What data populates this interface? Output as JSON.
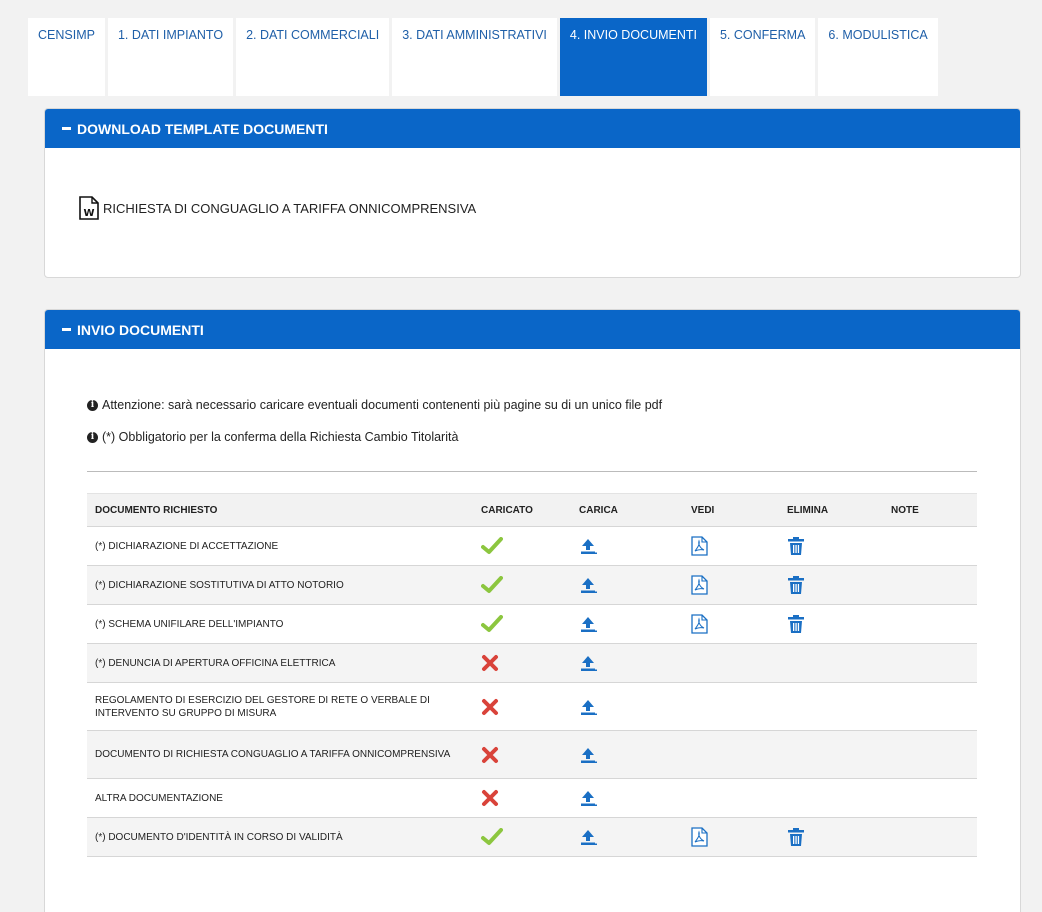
{
  "tabs": [
    {
      "label": "CENSIMP",
      "active": false
    },
    {
      "label": "1. DATI IMPIANTO",
      "active": false
    },
    {
      "label": "2. DATI COMMERCIALI",
      "active": false
    },
    {
      "label": "3. DATI AMMINISTRATIVI",
      "active": false
    },
    {
      "label": "4. INVIO DOCUMENTI",
      "active": true
    },
    {
      "label": "5. CONFERMA",
      "active": false
    },
    {
      "label": "6. MODULISTICA",
      "active": false
    }
  ],
  "download_panel": {
    "title": "DOWNLOAD TEMPLATE DOCUMENTI",
    "template_link": "RICHIESTA DI CONGUAGLIO A TARIFFA ONNICOMPRENSIVA",
    "template_icon": "word-doc-icon"
  },
  "invio_panel": {
    "title": "INVIO DOCUMENTI",
    "info_1": "Attenzione: sarà necessario caricare eventuali documenti contenenti più pagine su di un unico file pdf",
    "info_2": "(*) Obbligatorio per la conferma della Richiesta Cambio Titolarità"
  },
  "table": {
    "headers": [
      "DOCUMENTO RICHIESTO",
      "CARICATO",
      "CARICA",
      "VEDI",
      "ELIMINA",
      "NOTE"
    ],
    "rows": [
      {
        "name": "(*) DICHIARAZIONE DI ACCETTAZIONE",
        "uploaded": true
      },
      {
        "name": "(*) DICHIARAZIONE SOSTITUTIVA DI ATTO NOTORIO",
        "uploaded": true
      },
      {
        "name": "(*) SCHEMA UNIFILARE DELL'IMPIANTO",
        "uploaded": true
      },
      {
        "name": "(*) DENUNCIA DI APERTURA OFFICINA ELETTRICA",
        "uploaded": false
      },
      {
        "name": "REGOLAMENTO DI ESERCIZIO DEL GESTORE DI RETE O VERBALE DI INTERVENTO SU GRUPPO DI MISURA",
        "uploaded": false
      },
      {
        "name": "DOCUMENTO DI RICHIESTA CONGUAGLIO A TARIFFA ONNICOMPRENSIVA",
        "uploaded": false
      },
      {
        "name": "ALTRA DOCUMENTAZIONE",
        "uploaded": false
      },
      {
        "name": "(*) DOCUMENTO D'IDENTITÀ IN CORSO DI VALIDITÀ",
        "uploaded": true
      }
    ]
  },
  "colors": {
    "primary": "#0a66c8",
    "check": "#8cc63f",
    "cross": "#d9433a",
    "icon_blue": "#1a6fc4"
  }
}
